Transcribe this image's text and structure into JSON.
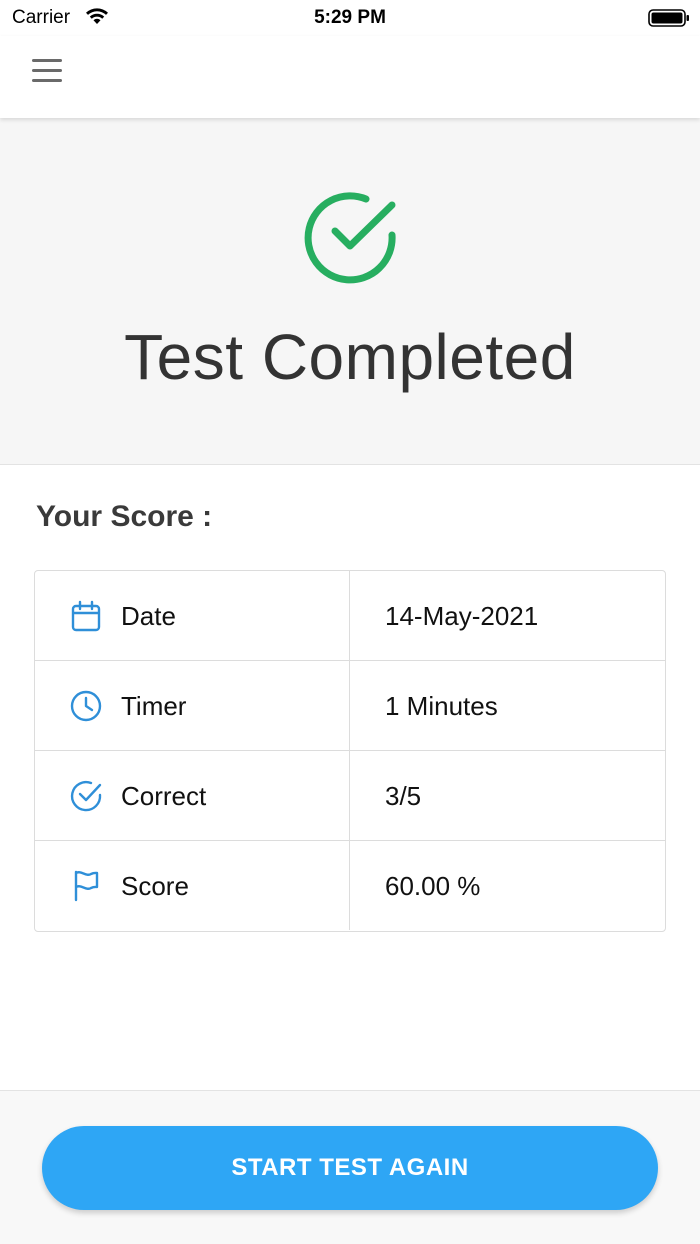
{
  "status_bar": {
    "carrier": "Carrier",
    "time": "5:29 PM",
    "wifi_icon": "wifi-icon",
    "battery_icon": "battery-icon"
  },
  "nav": {
    "menu_icon": "hamburger-menu-icon"
  },
  "hero": {
    "icon": "check-circle-icon",
    "icon_color": "#27ae60",
    "title": "Test Completed"
  },
  "score_section": {
    "heading": "Your Score :",
    "rows": [
      {
        "icon": "calendar-icon",
        "label": "Date",
        "value": "14-May-2021"
      },
      {
        "icon": "clock-icon",
        "label": "Timer",
        "value": "1 Minutes"
      },
      {
        "icon": "check-circle-icon",
        "label": "Correct",
        "value": "3/5"
      },
      {
        "icon": "flag-icon",
        "label": "Score",
        "value": "60.00 %"
      }
    ],
    "icon_color": "#2f8fd8"
  },
  "footer": {
    "button_label": "START TEST AGAIN",
    "button_color": "#2ea6f5"
  }
}
